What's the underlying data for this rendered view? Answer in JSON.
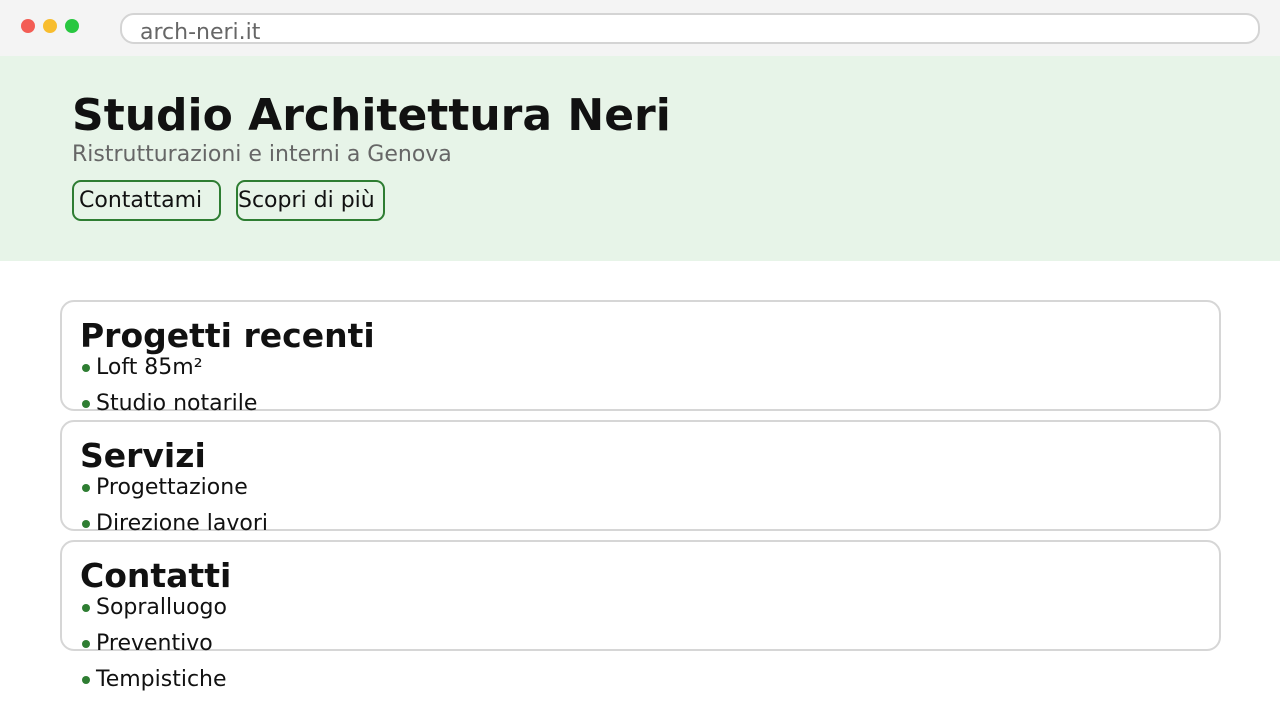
{
  "browser": {
    "url": "arch-neri.it"
  },
  "hero": {
    "title": "Studio Architettura Neri",
    "subtitle": "Ristrutturazioni e interni a Genova",
    "buttons": {
      "contact_label": "Contattami",
      "more_label": "Scopri di più"
    }
  },
  "sections": [
    {
      "title": "Progetti recenti",
      "items": [
        "Loft 85m²",
        "Studio notarile"
      ]
    },
    {
      "title": "Servizi",
      "items": [
        "Progettazione",
        "Direzione lavori"
      ]
    },
    {
      "title": "Contatti",
      "items": [
        "Sopralluogo",
        "Preventivo",
        "Tempistiche"
      ]
    }
  ],
  "colors": {
    "accent": "#2e7d32",
    "hero_background": "#e7f4e8"
  }
}
